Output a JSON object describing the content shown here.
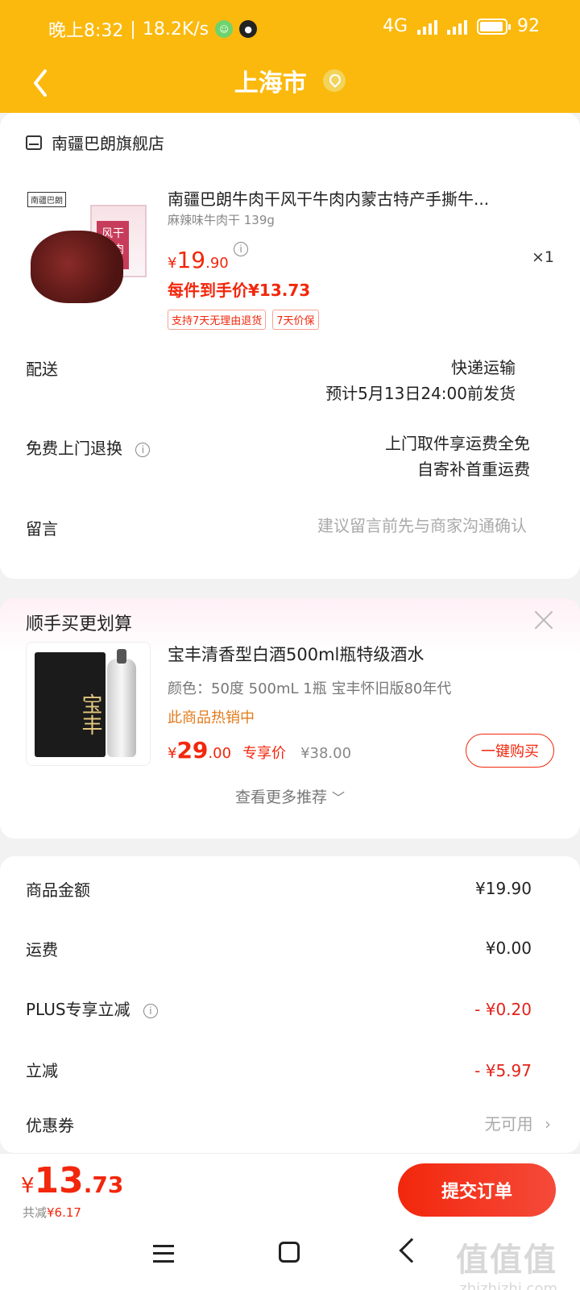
{
  "status_bar": {
    "time": "晚上8:32",
    "net_speed": "18.2K/s",
    "network": "4G",
    "battery": "92"
  },
  "header": {
    "title": "上海市",
    "back_icon": "chevron-left-icon",
    "location_icon": "location-pin-icon"
  },
  "order_card": {
    "store_name": "南疆巴朗旗舰店",
    "product": {
      "box_label": "风干牛肉",
      "brand_mark": "南疆巴朗",
      "title": "南疆巴朗牛肉干风干牛肉内蒙古特产手撕牛...",
      "spec": "麻辣味牛肉干 139g",
      "price_int": "19",
      "price_dec": ".90",
      "currency": "¥",
      "quantity": "×1",
      "final_price": "每件到手价¥13.73",
      "tags": [
        "支持7天无理由退货",
        "7天价保"
      ]
    },
    "delivery": {
      "label": "配送",
      "method": "快递运输",
      "eta": "预计5月13日24:00前发货"
    },
    "return": {
      "label": "免费上门退换",
      "line1": "上门取件享运费全免",
      "line2": "自寄补首重运费"
    },
    "message": {
      "label": "留言",
      "placeholder": "建议留言前先与商家沟通确认"
    }
  },
  "recommend": {
    "title": "顺手买更划算",
    "item": {
      "box_text": "宝丰",
      "name": "宝丰清香型白酒500ml瓶特级酒水",
      "spec": "颜色：50度 500mL 1瓶 宝丰怀旧版80年代",
      "hot": "此商品热销中",
      "currency": "¥",
      "price_int": "29",
      "price_dec": ".00",
      "exclusive": "专享价",
      "original": "¥38.00",
      "buy_label": "一键购买"
    },
    "more_label": "查看更多推荐"
  },
  "summary": {
    "rows": [
      {
        "label": "商品金额",
        "value": "¥19.90"
      },
      {
        "label": "运费",
        "value": "¥0.00"
      },
      {
        "label": "PLUS专享立减",
        "value": "- ¥0.20"
      },
      {
        "label": "立减",
        "value": "- ¥5.97"
      },
      {
        "label": "优惠券",
        "value": "无可用"
      }
    ]
  },
  "bottom": {
    "currency": "¥",
    "total_int": "13",
    "total_dec": ".73",
    "saved_label": "共减",
    "saved_value": "¥6.17",
    "submit_label": "提交订单"
  },
  "watermark": {
    "text": "值值值",
    "domain": "zhizhizhi.com"
  },
  "colors": {
    "brand_yellow": "#fbb90d",
    "price_red": "#f2270c",
    "hot_orange": "#e37b1c"
  }
}
